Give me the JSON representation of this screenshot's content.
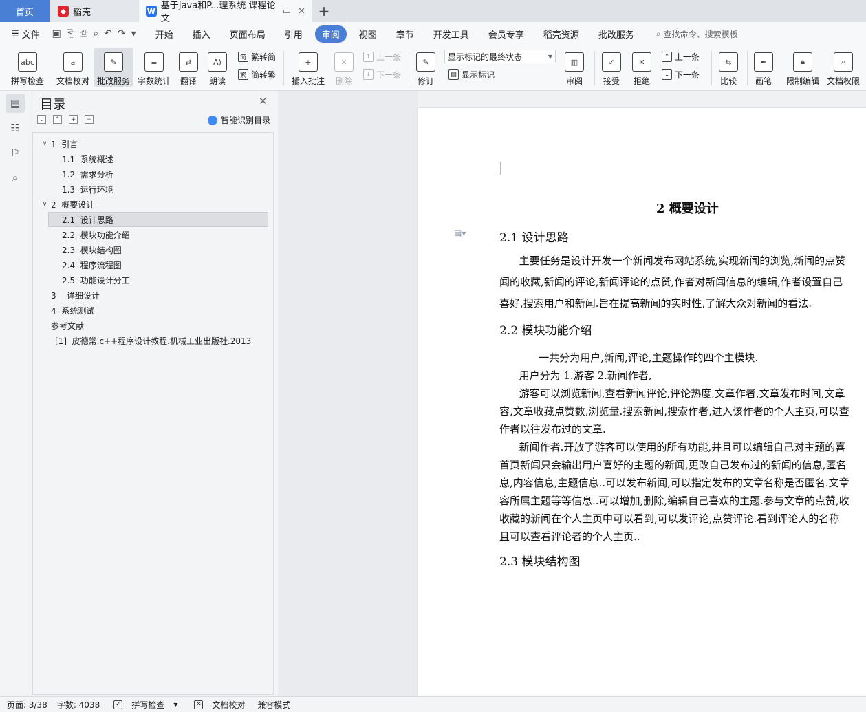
{
  "tabs": {
    "home": "首页",
    "daoke": "稻壳",
    "doc": "基于Java和P...理系统 课程论文"
  },
  "menu": {
    "file": "文件",
    "items": [
      "开始",
      "插入",
      "页面布局",
      "引用",
      "审阅",
      "视图",
      "章节",
      "开发工具",
      "会员专享",
      "稻壳资源",
      "批改服务"
    ],
    "active": "审阅",
    "search": "查找命令、搜索模板"
  },
  "ribbon": {
    "spell_check": "拼写检查",
    "doc_proof": "文档校对",
    "correct_service": "批改服务",
    "word_count": "字数统计",
    "translate": "翻译",
    "read_aloud": "朗读",
    "to_simplified": "繁转简",
    "to_traditional": "简转繁",
    "insert_comment": "插入批注",
    "delete": "删除",
    "prev": "上一条",
    "next": "下一条",
    "revise": "修订",
    "markup_state": "显示标记的最终状态",
    "show_markup": "显示标记",
    "review": "审阅",
    "accept": "接受",
    "reject": "拒绝",
    "prev2": "上一条",
    "next2": "下一条",
    "compare": "比较",
    "pen": "画笔",
    "restrict_edit": "限制编辑",
    "doc_permission": "文档权限"
  },
  "toc": {
    "title": "目录",
    "smart_detect": "智能识别目录",
    "items": [
      {
        "text": "1  引言",
        "level": 1,
        "expand": true
      },
      {
        "text": "1.1  系统概述",
        "level": 2
      },
      {
        "text": "1.2  需求分析",
        "level": 2
      },
      {
        "text": "1.3  运行环境",
        "level": 2
      },
      {
        "text": "2  概要设计",
        "level": 1,
        "expand": true
      },
      {
        "text": "2.1  设计思路",
        "level": 2,
        "selected": true
      },
      {
        "text": "2.2  模块功能介绍",
        "level": 2
      },
      {
        "text": "2.3  模块结构图",
        "level": 2
      },
      {
        "text": "2.4  程序流程图",
        "level": 2
      },
      {
        "text": "2.5  功能设计分工",
        "level": 2
      },
      {
        "text": "3    详细设计",
        "level": 1
      },
      {
        "text": "4  系统测试",
        "level": 1
      },
      {
        "text": "参考文献",
        "level": 1
      },
      {
        "text": "[1]  皮德常.c++程序设计教程.机械工业出版社.2013",
        "level": 3
      }
    ]
  },
  "document": {
    "chapter": "2  概要设计",
    "sec1": "2.1  设计思路",
    "sec1_lines": [
      "      主要任务是设计开发一个新闻发布网站系统,实现新闻的浏览,新闻的点赞",
      "闻的收藏,新闻的评论,新闻评论的点赞,作者对新闻信息的编辑,作者设置自己",
      "喜好,搜索用户和新闻.旨在提高新闻的实时性,了解大众对新闻的看法."
    ],
    "sec2": "2.2  模块功能介绍",
    "sec2_lines": [
      "            一共分为用户,新闻,评论,主题操作的四个主模块.",
      "      用户分为 1.游客 2.新闻作者,",
      "      游客可以浏览新闻,查看新闻评论,评论热度,文章作者,文章发布时间,文章",
      "容,文章收藏点赞数,浏览量.搜索新闻,搜索作者,进入该作者的个人主页,可以查",
      "作者以往发布过的文章.",
      "      新闻作者.开放了游客可以使用的所有功能,并且可以编辑自己对主题的喜",
      "首页新闻只会输出用户喜好的主题的新闻,更改自己发布过的新闻的信息,匿名",
      "息,内容信息,主题信息..可以发布新闻,可以指定发布的文章名称是否匿名.文章",
      "容所属主题等等信息..可以增加,删除,编辑自己喜欢的主题.参与文章的点赞,收",
      "收藏的新闻在个人主页中可以看到,可以发评论,点赞评论.看到评论人的名称",
      "且可以查看评论者的个人主页.."
    ],
    "sec3": "2.3  模块结构图"
  },
  "status": {
    "page": "页面: 3/38",
    "words": "字数: 4038",
    "spell": "拼写检查",
    "proof": "文档校对",
    "compat": "兼容模式"
  }
}
